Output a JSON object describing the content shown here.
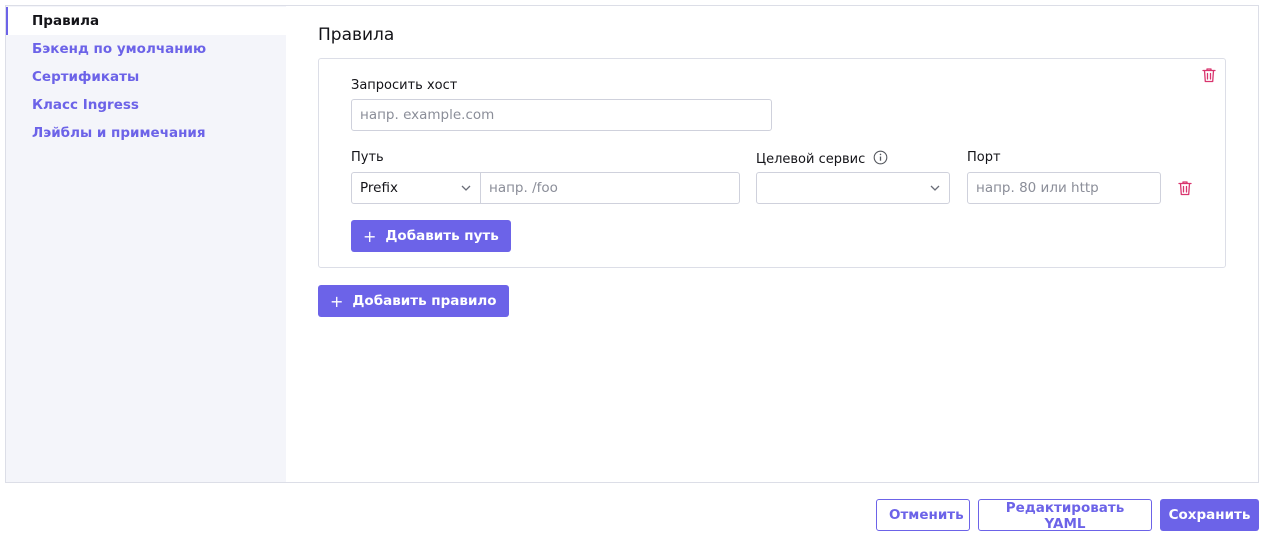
{
  "sidebar": {
    "items": [
      {
        "label": "Правила",
        "active": true
      },
      {
        "label": "Бэкенд по умолчанию"
      },
      {
        "label": "Сертификаты"
      },
      {
        "label": "Класс Ingress"
      },
      {
        "label": "Лэйблы и примечания"
      }
    ]
  },
  "main": {
    "title": "Правила",
    "rule": {
      "host_label": "Запросить хост",
      "host_placeholder": "напр. example.com",
      "path_label": "Путь",
      "path_type_value": "Prefix",
      "path_placeholder": "напр. /foo",
      "target_service_label": "Целевой сервис",
      "target_service_value": "",
      "port_label": "Порт",
      "port_placeholder": "напр. 80 или http",
      "add_path_label": "Добавить путь"
    },
    "add_rule_label": "Добавить правило"
  },
  "footer": {
    "cancel_label": "Отменить",
    "edit_yaml_label": "Редактировать YAML",
    "save_label": "Сохранить"
  },
  "colors": {
    "accent": "#6c63e8",
    "danger_icon": "#d9346e",
    "sidebar_bg": "#f4f5fa"
  }
}
